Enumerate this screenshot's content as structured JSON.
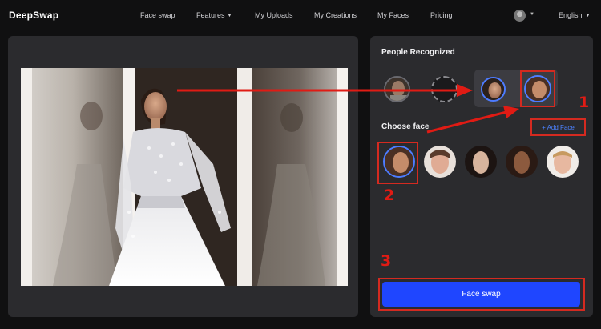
{
  "app": {
    "logo_text": "DeepSwap"
  },
  "nav": {
    "items": [
      {
        "label": "Face swap"
      },
      {
        "label": "Features"
      },
      {
        "label": "My Uploads"
      },
      {
        "label": "My Creations"
      },
      {
        "label": "My Faces"
      },
      {
        "label": "Pricing"
      }
    ],
    "language": "English"
  },
  "side": {
    "recognized_title": "People Recognized",
    "choose_title": "Choose face",
    "add_face_label": "+ Add Face",
    "swap_button_label": "Face swap"
  },
  "annotations": {
    "step1": "1",
    "step2": "2",
    "step3": "3"
  },
  "colors": {
    "accent_blue": "#1f46ff",
    "annotation_red": "#d42a20",
    "panel": "#2b2b2e",
    "background": "#101011"
  }
}
